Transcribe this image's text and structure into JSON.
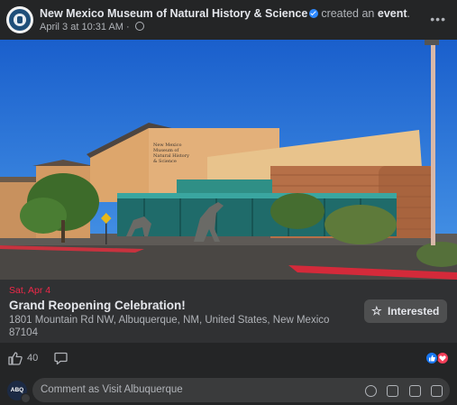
{
  "post": {
    "page_name": "New Mexico Museum of Natural History & Science",
    "action_prefix": "created an",
    "action_object": "event",
    "action_suffix": ".",
    "timestamp": "April 3 at 10:31 AM",
    "separator": "·",
    "more_label": "•••"
  },
  "photo": {
    "building_sign": [
      "New Mexico",
      "Museum of",
      "Natural History",
      "& Science"
    ]
  },
  "event": {
    "date": "Sat, Apr 4",
    "title": "Grand Reopening Celebration!",
    "address": "1801 Mountain Rd NW, Albuquerque, NM, United States, New Mexico 87104",
    "interested_label": "Interested",
    "star_icon": "☆"
  },
  "reactions": {
    "like_count": "40",
    "types": [
      "like",
      "love"
    ]
  },
  "comment": {
    "avatar_text": "ABQ",
    "placeholder": "Comment as Visit Albuquerque",
    "icons": [
      "emoji-icon",
      "camera-icon",
      "gif-icon",
      "sticker-icon"
    ]
  },
  "colors": {
    "background": "#242526",
    "event_date": "#f02849",
    "verified": "#2d88ff",
    "sky": "#1f6fd6"
  }
}
